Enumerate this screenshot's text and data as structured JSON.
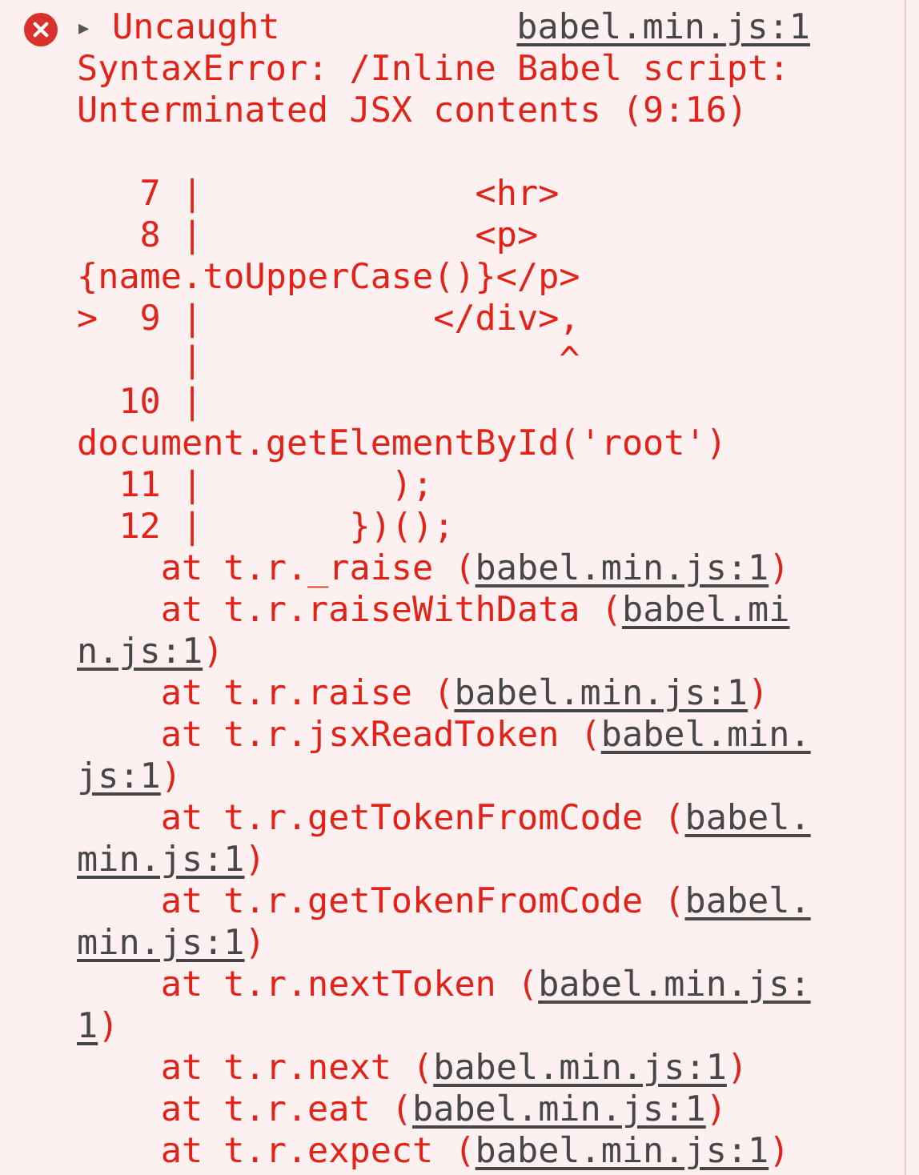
{
  "entry": {
    "toggle": "▶",
    "label": "Uncaught",
    "source": "babel.min.js:1",
    "message": "SyntaxError: /Inline Babel script: Unterminated JSX contents (9:16)",
    "code_lines": [
      "   7 |             <hr>",
      "   8 |             <p> {name.toUpperCase()}</p>",
      ">  9 |           </div>,",
      "     |                 ^",
      "  10 |         document.getElementById('root')",
      "  11 |         );",
      "  12 |       })();"
    ],
    "stack": [
      {
        "lines": [
          {
            "text": "at t.r._raise (",
            "link": "babel.min.js:1",
            "after": ")"
          }
        ]
      },
      {
        "lines": [
          {
            "text": "at t.r.raiseWithData (",
            "link": "babel.mi"
          },
          {
            "link": "n.js:1",
            "after": ")"
          }
        ]
      },
      {
        "lines": [
          {
            "text": "at t.r.raise (",
            "link": "babel.min.js:1",
            "after": ")"
          }
        ]
      },
      {
        "lines": [
          {
            "text": "at t.r.jsxReadToken (",
            "link": "babel.min."
          },
          {
            "link": "js:1",
            "after": ")"
          }
        ]
      },
      {
        "lines": [
          {
            "text": "at t.r.getTokenFromCode (",
            "link": "babel."
          },
          {
            "link": "min.js:1",
            "after": ")"
          }
        ]
      },
      {
        "lines": [
          {
            "text": "at t.r.getTokenFromCode (",
            "link": "babel."
          },
          {
            "link": "min.js:1",
            "after": ")"
          }
        ]
      },
      {
        "lines": [
          {
            "text": "at t.r.nextToken (",
            "link": "babel.min.js:"
          },
          {
            "link": "1",
            "after": ")"
          }
        ]
      },
      {
        "lines": [
          {
            "text": "at t.r.next (",
            "link": "babel.min.js:1",
            "after": ")"
          }
        ]
      },
      {
        "lines": [
          {
            "text": "at t.r.eat (",
            "link": "babel.min.js:1",
            "after": ")"
          }
        ]
      },
      {
        "lines": [
          {
            "text": "at t.r.expect (",
            "link": "babel.min.js:1",
            "after": ")"
          }
        ]
      }
    ]
  }
}
